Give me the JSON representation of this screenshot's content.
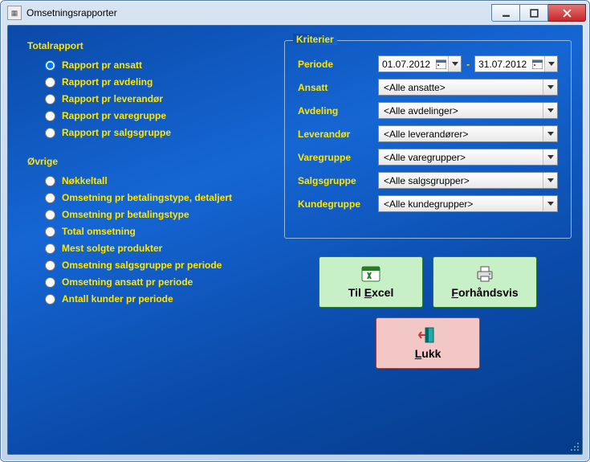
{
  "window": {
    "title": "Omsetningsrapporter"
  },
  "totalrapport": {
    "title": "Totalrapport",
    "items": [
      {
        "label": "Rapport pr ansatt",
        "selected": true
      },
      {
        "label": "Rapport pr avdeling",
        "selected": false
      },
      {
        "label": "Rapport pr leverandør",
        "selected": false
      },
      {
        "label": "Rapport pr varegruppe",
        "selected": false
      },
      {
        "label": "Rapport pr salgsgruppe",
        "selected": false
      }
    ]
  },
  "ovrige": {
    "title": "Øvrige",
    "items": [
      {
        "label": "Nøkkeltall",
        "selected": false
      },
      {
        "label": "Omsetning pr betalingstype, detaljert",
        "selected": false
      },
      {
        "label": "Omsetning pr betalingstype",
        "selected": false
      },
      {
        "label": "Total omsetning",
        "selected": false
      },
      {
        "label": "Mest solgte produkter",
        "selected": false
      },
      {
        "label": "Omsetning salgsgruppe pr periode",
        "selected": false
      },
      {
        "label": "Omsetning ansatt pr periode",
        "selected": false
      },
      {
        "label": "Antall kunder pr periode",
        "selected": false
      }
    ]
  },
  "kriterier": {
    "legend": "Kriterier",
    "periode_label": "Periode",
    "periode_from": "01.07.2012",
    "periode_to": "31.07.2012",
    "dash": "-",
    "ansatt": {
      "label": "Ansatt",
      "value": "<Alle ansatte>"
    },
    "avdeling": {
      "label": "Avdeling",
      "value": "<Alle avdelinger>"
    },
    "leverandor": {
      "label": "Leverandør",
      "value": "<Alle leverandører>"
    },
    "varegruppe": {
      "label": "Varegruppe",
      "value": "<Alle varegrupper>"
    },
    "salgsgruppe": {
      "label": "Salgsgruppe",
      "value": "<Alle salgsgrupper>"
    },
    "kundegruppe": {
      "label": "Kundegruppe",
      "value": "<Alle kundegrupper>"
    }
  },
  "actions": {
    "excel": {
      "pre": "Til ",
      "accel": "E",
      "post": "xcel"
    },
    "forhandsvis": {
      "pre": "",
      "accel": "F",
      "post": "orhåndsvis"
    },
    "lukk": {
      "pre": "",
      "accel": "L",
      "post": "ukk"
    }
  }
}
